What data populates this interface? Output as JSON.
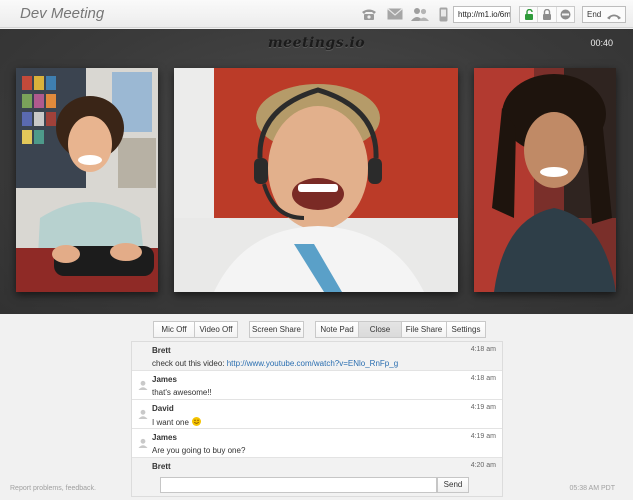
{
  "header": {
    "title": "Dev Meeting",
    "url": "http://m1.io/6m",
    "end_label": "End"
  },
  "icons": [
    "phone-icon",
    "mail-icon",
    "users-icon",
    "mobile-icon",
    "unlock-icon",
    "lock-icon",
    "block-icon",
    "hangup-icon"
  ],
  "stage": {
    "brand": "meetings.io",
    "timer": "00:40"
  },
  "toolbar": {
    "mic_off": "Mic Off",
    "video_off": "Video Off",
    "screen_share": "Screen Share",
    "note_pad": "Note Pad",
    "close": "Close",
    "file_share": "File Share",
    "settings": "Settings"
  },
  "chat": {
    "messages": [
      {
        "sender": "Brett",
        "time": "4:18 am",
        "text": "check out this video: ",
        "link": "http://www.youtube.com/watch?v=ENlo_RnFp_g"
      },
      {
        "sender": "James",
        "time": "4:18 am",
        "text": "that's awesome!!"
      },
      {
        "sender": "David",
        "time": "4:19 am",
        "text": "I want one"
      },
      {
        "sender": "James",
        "time": "4:19 am",
        "text": "Are you going to buy one?"
      },
      {
        "sender": "Brett",
        "time": "4:20 am"
      }
    ],
    "input_placeholder": "",
    "send_label": "Send"
  },
  "footer": {
    "report": "Report problems, feedback.",
    "time": "05:38 AM PDT"
  },
  "colors": {
    "stage_bg": "#3d3d3d",
    "link": "#2a6eb0",
    "lock_green": "#2e9a3a"
  }
}
